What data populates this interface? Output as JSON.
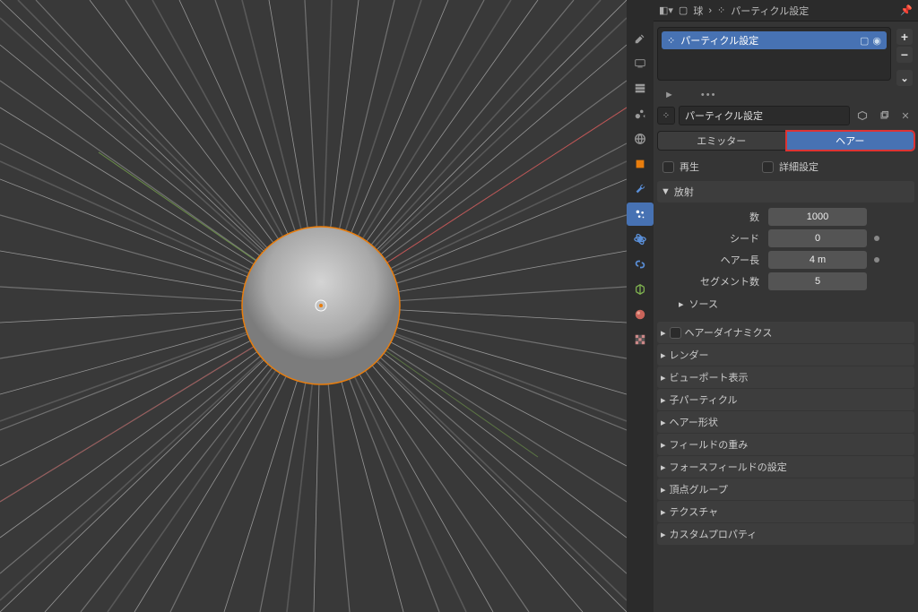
{
  "breadcrumb": {
    "object": "球",
    "data": "パーティクル設定"
  },
  "list": {
    "item_name": "パーティクル設定",
    "expand_label": "►",
    "spacer": "•••"
  },
  "datablock": {
    "name": "パーティクル設定"
  },
  "type_tabs": {
    "emitter": "エミッター",
    "hair": "ヘアー"
  },
  "checks": {
    "regrow": "再生",
    "advanced": "詳細設定"
  },
  "emission": {
    "title": "放射",
    "number_label": "数",
    "number_value": "1000",
    "seed_label": "シード",
    "seed_value": "0",
    "hair_length_label": "ヘアー長",
    "hair_length_value": "4 m",
    "segments_label": "セグメント数",
    "segments_value": "5",
    "source_label": "ソース"
  },
  "panels": {
    "hair_dynamics": "ヘアーダイナミクス",
    "render": "レンダー",
    "viewport": "ビューポート表示",
    "children": "子パーティクル",
    "hair_shape": "ヘアー形状",
    "field_weights": "フィールドの重み",
    "force_field": "フォースフィールドの設定",
    "vertex_groups": "頂点グループ",
    "textures": "テクスチャ",
    "custom_props": "カスタムプロパティ"
  }
}
